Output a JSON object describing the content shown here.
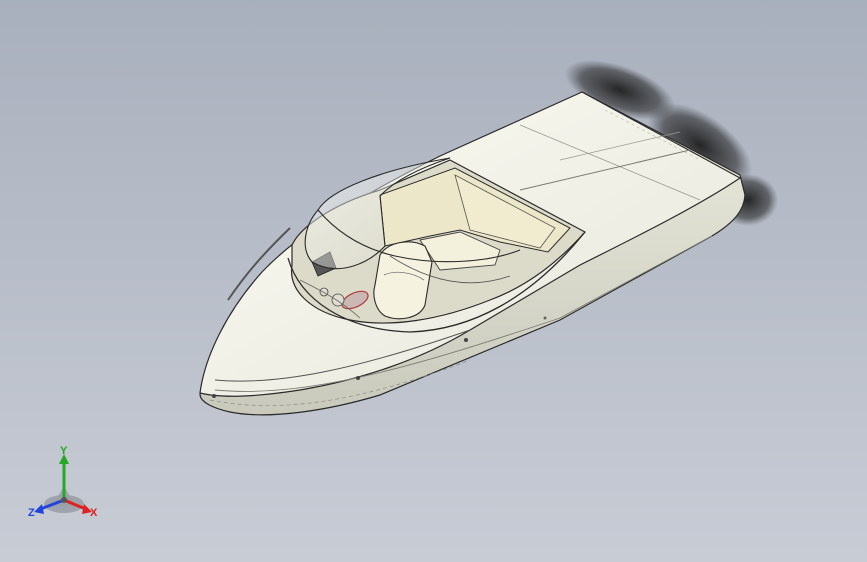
{
  "viewport": {
    "background_top": "#a9b0bd",
    "background_bottom": "#c8ccd5"
  },
  "model": {
    "icon": "speedboat-3d-model",
    "hull_color": "#f2f1e6",
    "interior_color": "#ece7c8",
    "outline_color": "#2a2a2a"
  },
  "triad": {
    "y_label": "Y",
    "x_label": "X",
    "z_label": "Z",
    "y_color": "#22aa22",
    "x_color": "#dd2222",
    "z_color": "#2244dd"
  }
}
